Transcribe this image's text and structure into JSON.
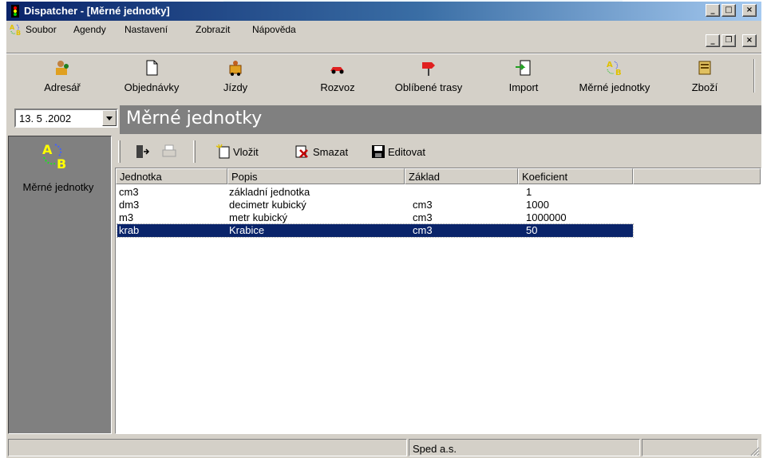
{
  "window": {
    "title": "Dispatcher - [Měrné jednotky]"
  },
  "menu": {
    "items": [
      "Soubor",
      "Agendy",
      "Nastavení",
      "Zobrazit",
      "Nápověda"
    ]
  },
  "toolbar": {
    "buttons": [
      {
        "label": "Adresář",
        "icon": "address-book-icon"
      },
      {
        "label": "Objednávky",
        "icon": "document-icon"
      },
      {
        "label": "Jízdy",
        "icon": "truck-driver-icon"
      },
      {
        "label": "Rozvoz",
        "icon": "car-icon"
      },
      {
        "label": "Oblíbené trasy",
        "icon": "route-sign-icon"
      },
      {
        "label": "Import",
        "icon": "import-icon"
      },
      {
        "label": "Měrné jednotky",
        "icon": "units-ab-icon"
      },
      {
        "label": "Zboží",
        "icon": "goods-icon"
      }
    ]
  },
  "date": {
    "value": "13. 5 .2002"
  },
  "page": {
    "title": "Měrné jednotky"
  },
  "sidebar": {
    "label": "Měrné jednotky"
  },
  "actions": {
    "insert": "Vložit",
    "delete": "Smazat",
    "edit": "Editovat"
  },
  "table": {
    "columns": [
      "Jednotka",
      "Popis",
      "Základ",
      "Koeficient"
    ],
    "rows": [
      [
        "cm3",
        "základní jednotka",
        "",
        "1"
      ],
      [
        "dm3",
        "decimetr kubický",
        "cm3",
        "1000"
      ],
      [
        "m3",
        "metr kubický",
        "cm3",
        "1000000"
      ],
      [
        "krab",
        "Krabice",
        "cm3",
        "50"
      ]
    ],
    "selected_row": 3
  },
  "status": {
    "company": "Sped a.s."
  },
  "colors": {
    "selection": "#0a246a",
    "header_band": "#808080",
    "face": "#d4d0c8"
  }
}
